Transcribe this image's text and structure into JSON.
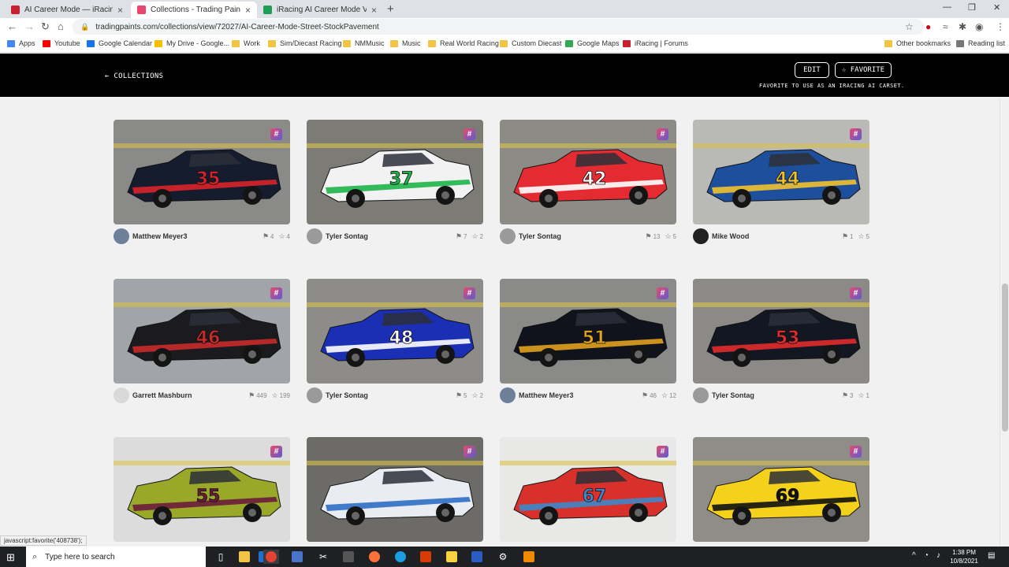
{
  "browser": {
    "tabs": [
      {
        "title": "AI Career Mode — iRacing Forum",
        "favicon_color": "#c8202f"
      },
      {
        "title": "Collections - Trading Paints",
        "favicon_color": "#e8466b"
      },
      {
        "title": "iRacing AI Career Mode Version",
        "favicon_color": "#1f9d55"
      }
    ],
    "new_tab": "+",
    "url": "tradingpaints.com/collections/view/72027/AI-Career-Mode-Street-StockPavement",
    "bookmarks": [
      {
        "label": "Apps",
        "color": "#4285f4"
      },
      {
        "label": "Youtube",
        "color": "#ff0000"
      },
      {
        "label": "Google Calendar",
        "color": "#1a73e8"
      },
      {
        "label": "My Drive - Google...",
        "color": "#fbbc04"
      },
      {
        "label": "Work",
        "color": "#f3c343"
      },
      {
        "label": "Sim/Diecast Racing",
        "color": "#f3c343"
      },
      {
        "label": "NMMusic",
        "color": "#f3c343"
      },
      {
        "label": "Music",
        "color": "#f3c343"
      },
      {
        "label": "Real World Racing",
        "color": "#f3c343"
      },
      {
        "label": "Custom Diecast",
        "color": "#f3c343"
      },
      {
        "label": "Google Maps",
        "color": "#34a853"
      },
      {
        "label": "iRacing | Forums",
        "color": "#c8202f"
      }
    ],
    "other_bookmarks": "Other bookmarks",
    "reading_list": "Reading list"
  },
  "header": {
    "back_label": "← COLLECTIONS",
    "edit_label": "EDIT",
    "favorite_label": "☆ FAVORITE",
    "favorite_note": "FAVORITE TO USE AS AN IRACING AI CARSET."
  },
  "cards": [
    {
      "author": "Matthew Meyer3",
      "paints": "4",
      "favorites": "4",
      "number": "35",
      "body": "#151c2e",
      "accent": "#d8232a",
      "bg": "#8a8a88",
      "avatar": "#6e7f99"
    },
    {
      "author": "Tyler Sontag",
      "paints": "7",
      "favorites": "2",
      "number": "37",
      "body": "#f2f2f2",
      "accent": "#1eb44a",
      "bg": "#7d7b76",
      "avatar": "#9a9a9a"
    },
    {
      "author": "Tyler Sontag",
      "paints": "13",
      "favorites": "5",
      "number": "42",
      "body": "#e52b32",
      "accent": "#ffffff",
      "bg": "#8d8b86",
      "avatar": "#9a9a9a"
    },
    {
      "author": "Mike Wood",
      "paints": "1",
      "favorites": "5",
      "number": "44",
      "body": "#1d4f9c",
      "accent": "#f2c12e",
      "bg": "#b9b9b6",
      "avatar": "#222222"
    },
    {
      "author": "Garrett Mashburn",
      "paints": "449",
      "favorites": "199",
      "number": "46",
      "body": "#1b1b1f",
      "accent": "#c92a2a",
      "bg": "#a1a4a8",
      "avatar": "#d9d9d9"
    },
    {
      "author": "Tyler Sontag",
      "paints": "5",
      "favorites": "2",
      "number": "48",
      "body": "#1b2fb5",
      "accent": "#ffffff",
      "bg": "#8e8c88",
      "avatar": "#9a9a9a"
    },
    {
      "author": "Matthew Meyer3",
      "paints": "46",
      "favorites": "12",
      "number": "51",
      "body": "#10131c",
      "accent": "#e0a21f",
      "bg": "#8a8a88",
      "avatar": "#6e7f99"
    },
    {
      "author": "Tyler Sontag",
      "paints": "3",
      "favorites": "1",
      "number": "53",
      "body": "#131722",
      "accent": "#e22b2b",
      "bg": "#8c8a86",
      "avatar": "#9a9a9a"
    },
    {
      "author": "",
      "paints": "",
      "favorites": "",
      "number": "55",
      "body": "#9aa82a",
      "accent": "#6b1b3a",
      "bg": "#dcdcdc",
      "avatar": "#cccccc"
    },
    {
      "author": "",
      "paints": "",
      "favorites": "",
      "number": "",
      "body": "#e9ecf2",
      "accent": "#2e6fc4",
      "bg": "#6d6b67",
      "avatar": "#cccccc"
    },
    {
      "author": "",
      "paints": "",
      "favorites": "",
      "number": "67",
      "body": "#d8312b",
      "accent": "#3d88c9",
      "bg": "#e8e8e6",
      "avatar": "#cccccc"
    },
    {
      "author": "",
      "paints": "",
      "favorites": "",
      "number": "69",
      "body": "#f4d21c",
      "accent": "#111111",
      "bg": "#8f8d88",
      "avatar": "#cccccc"
    }
  ],
  "status_url": "javascript:favorite('408738');",
  "taskbar": {
    "search_placeholder": "Type here to search",
    "time": "1:38 PM",
    "date": "10/8/2021"
  }
}
